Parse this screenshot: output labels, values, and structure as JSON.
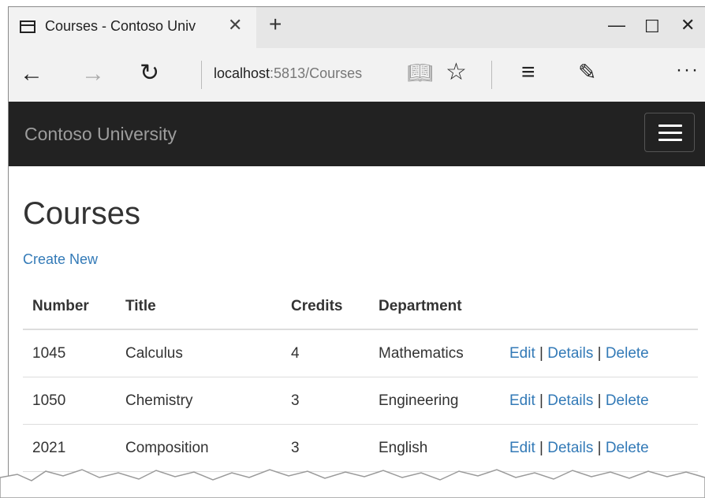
{
  "browser": {
    "tab_title": "Courses - Contoso Univ",
    "url_host": "localhost",
    "url_rest": ":5813/Courses"
  },
  "icons": {
    "tab": "tab-page-icon",
    "close": "close-icon",
    "new_tab": "plus-icon",
    "back": "back-arrow-icon",
    "forward": "forward-arrow-icon",
    "refresh": "refresh-icon",
    "reading": "reading-view-icon",
    "favorite": "star-icon",
    "hub": "hub-icon",
    "note": "web-note-icon",
    "more": "more-icon",
    "menu": "hamburger-icon"
  },
  "site": {
    "brand": "Contoso University",
    "page_title": "Courses",
    "create_new": "Create New"
  },
  "table": {
    "headers": [
      "Number",
      "Title",
      "Credits",
      "Department"
    ],
    "rows": [
      {
        "number": "1045",
        "title": "Calculus",
        "credits": "4",
        "department": "Mathematics"
      },
      {
        "number": "1050",
        "title": "Chemistry",
        "credits": "3",
        "department": "Engineering"
      },
      {
        "number": "2021",
        "title": "Composition",
        "credits": "3",
        "department": "English"
      }
    ],
    "actions": {
      "edit": "Edit",
      "details": "Details",
      "delete": "Delete",
      "separator": "|"
    }
  },
  "colors": {
    "link": "#337ab7",
    "navbar": "#222222",
    "brand": "#9d9d9d"
  }
}
